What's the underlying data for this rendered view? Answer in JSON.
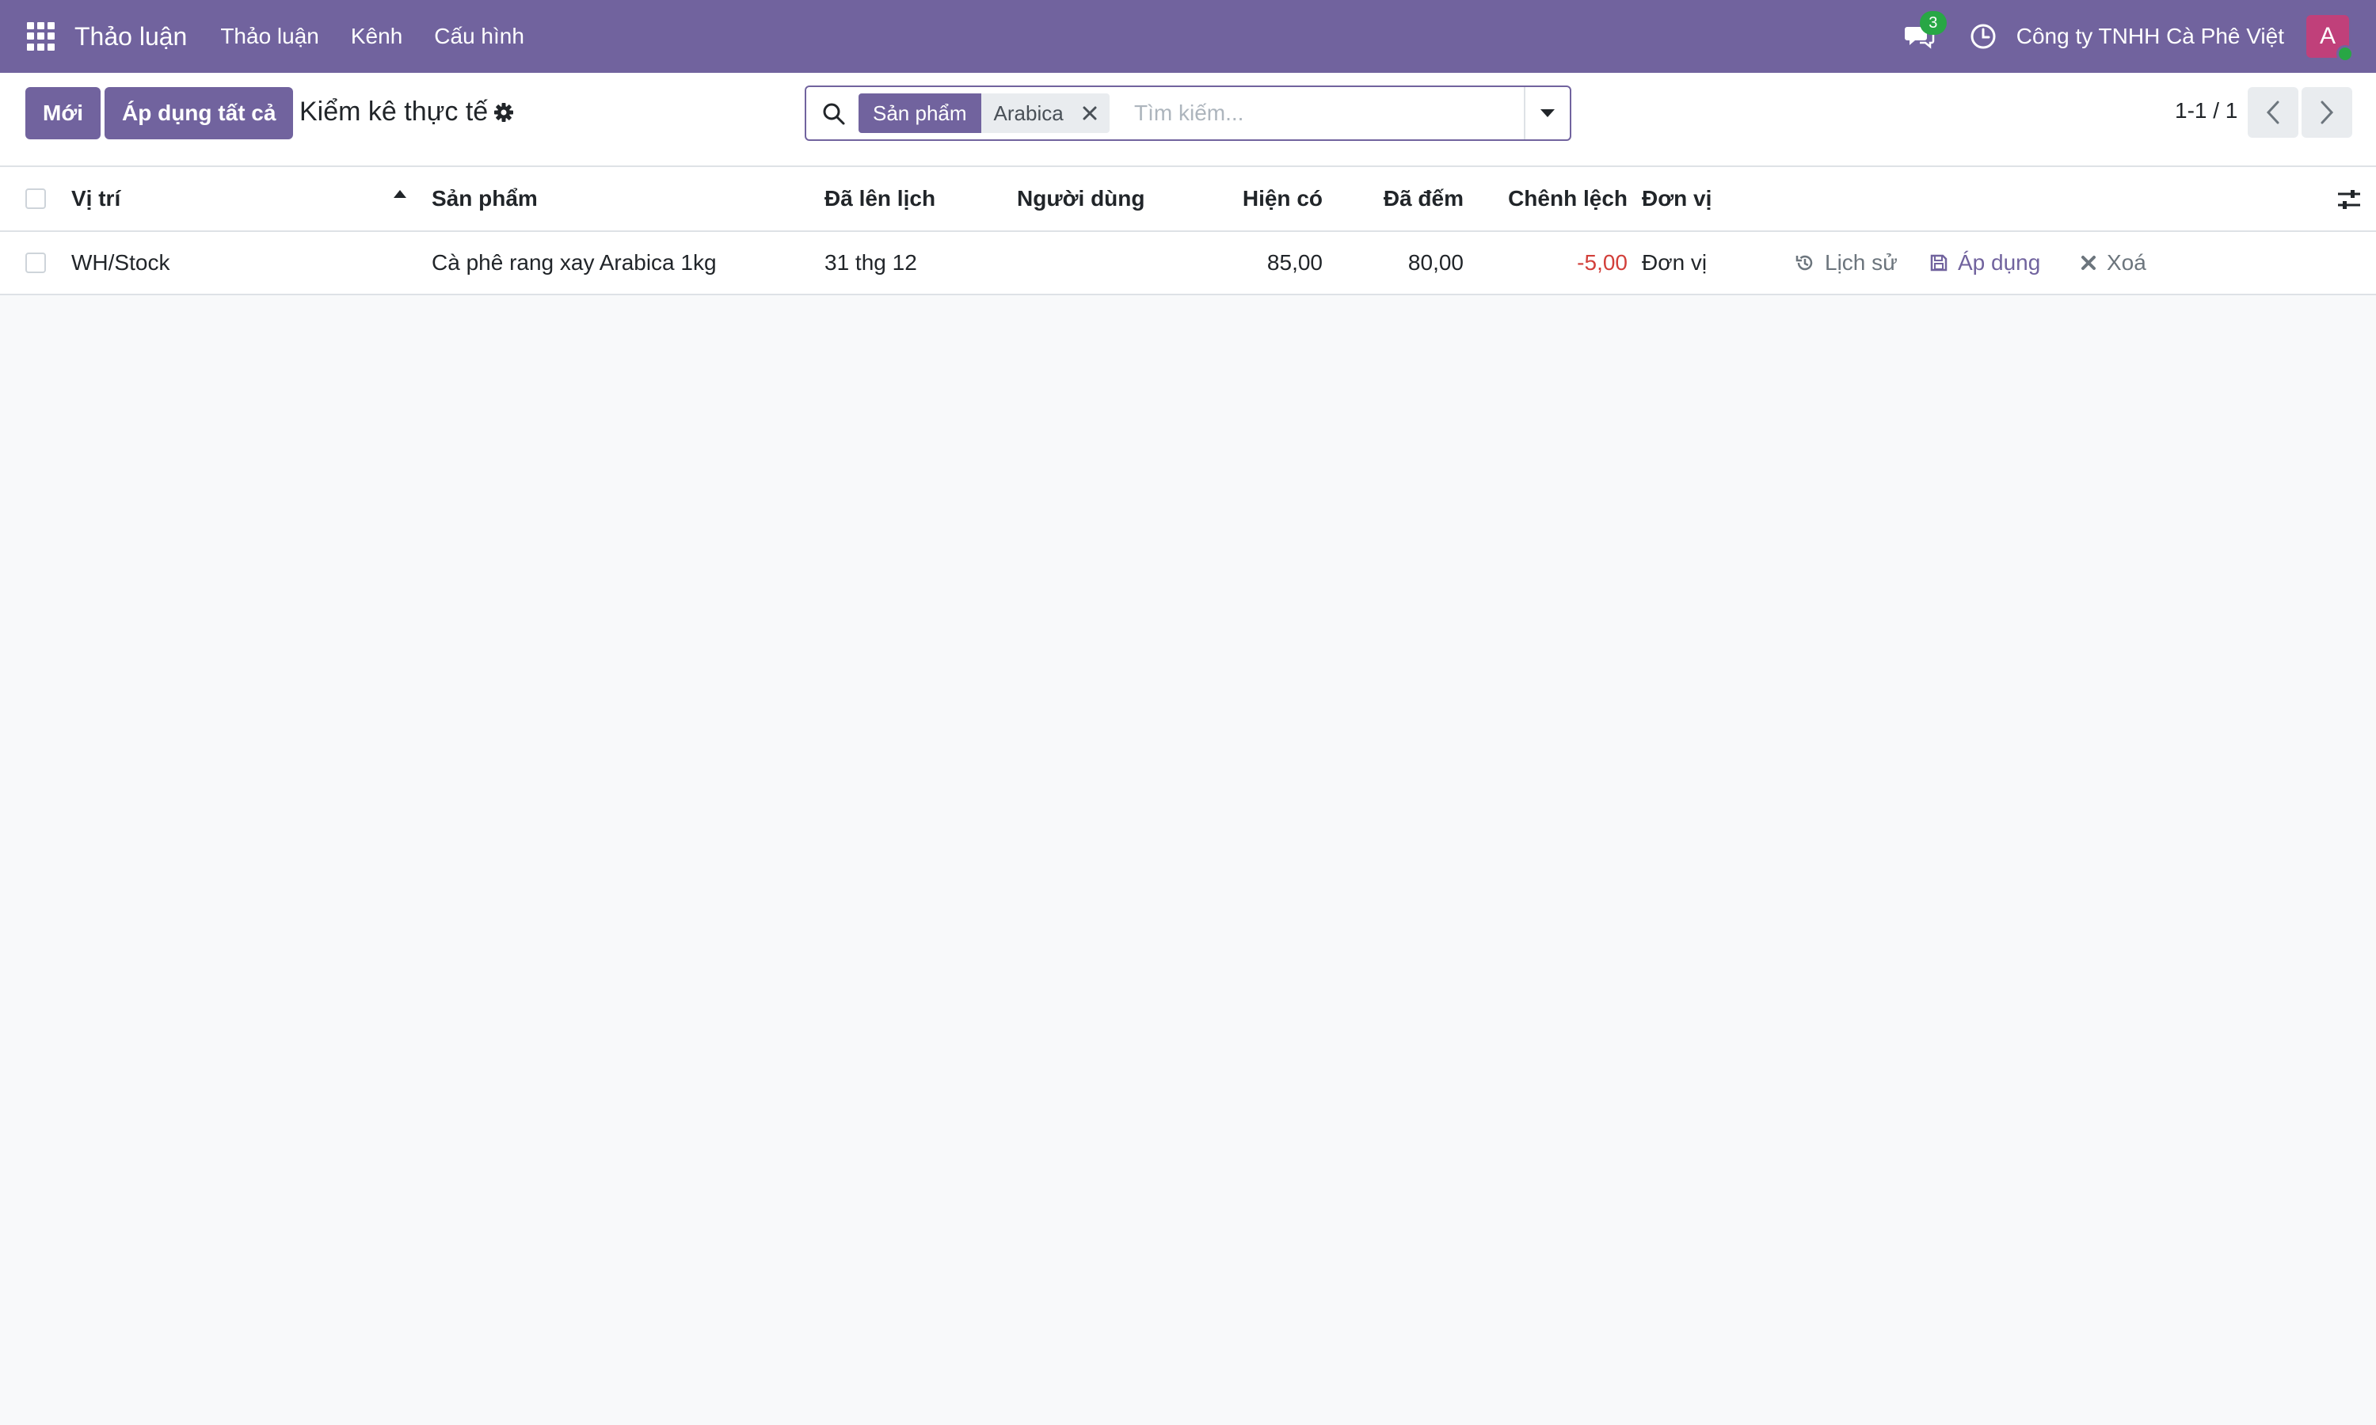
{
  "navbar": {
    "app_name": "Thảo luận",
    "menu": [
      "Thảo luận",
      "Kênh",
      "Cấu hình"
    ],
    "messages_count": "3",
    "company": "Công ty TNHH Cà Phê Việt",
    "avatar_initial": "A",
    "bg_color": "#71639e",
    "icons": [
      "apps-grid-icon",
      "chat-icon",
      "clock-icon"
    ]
  },
  "control_panel": {
    "new_button": "Mới",
    "apply_all_button": "Áp dụng tất cả",
    "title": "Kiểm kê thực tế",
    "search": {
      "facet_label": "Sản phẩm",
      "facet_value": "Arabica",
      "placeholder": "Tìm kiếm..."
    },
    "pager": "1-1 / 1"
  },
  "table": {
    "headers": {
      "location": "Vị trí",
      "product": "Sản phẩm",
      "scheduled": "Đã lên lịch",
      "user": "Người dùng",
      "on_hand": "Hiện có",
      "counted": "Đã đếm",
      "difference": "Chênh lệch",
      "uom": "Đơn vị"
    },
    "sorted_by": "location",
    "rows": [
      {
        "location": "WH/Stock",
        "product": "Cà phê rang xay Arabica 1kg",
        "scheduled": "31 thg 12",
        "user": "",
        "on_hand": "85,00",
        "counted": "80,00",
        "difference": "-5,00",
        "uom": "Đơn vị",
        "actions": {
          "history": "Lịch sử",
          "apply": "Áp dụng",
          "delete": "Xoá"
        }
      }
    ]
  },
  "colors": {
    "primary": "#71639e",
    "negative": "#d23f3a",
    "badge": "#28a745"
  }
}
